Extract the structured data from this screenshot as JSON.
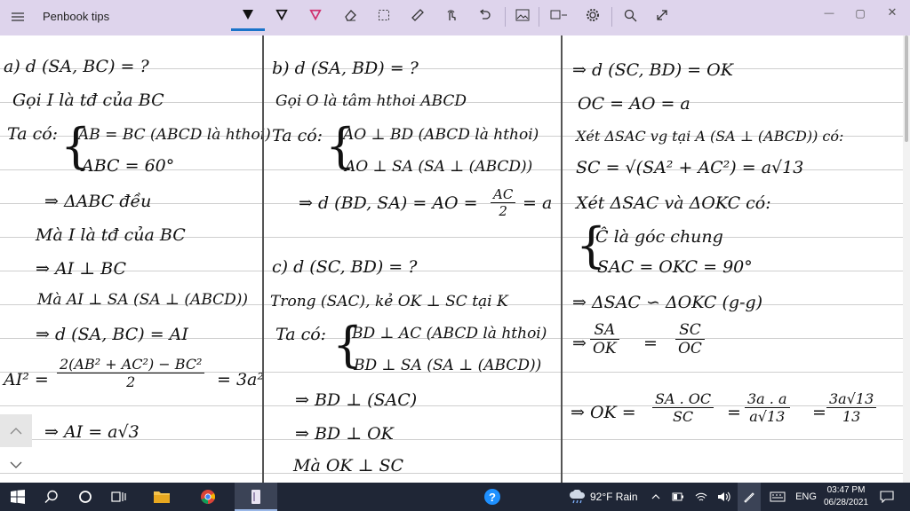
{
  "app": {
    "title": "Penbook tips"
  },
  "toolbar": {
    "icons": [
      "pen-icon",
      "pen-icon",
      "highlighter-icon",
      "eraser-icon",
      "lasso-icon",
      "ruler-icon",
      "touch-icon",
      "undo-icon",
      "image-icon",
      "shape-icon",
      "settings-icon",
      "search-icon",
      "expand-icon"
    ]
  },
  "window": {
    "minimize": "—",
    "maximize": "▢",
    "close": "✕"
  },
  "col1": [
    "a) d (SA, BC) = ?",
    "Gọi I là tđ của BC",
    "Ta có:",
    "AB = BC (ABCD là hthoi)",
    "ABC = 60°",
    "⇒ ΔABC đều",
    "Mà I là tđ của BC",
    "⇒ AI ⊥ BC",
    "Mà AI ⊥ SA (SA ⊥ (ABCD))",
    "⇒ d (SA, BC) = AI",
    "AI² =",
    "2(AB² + AC²) − BC²",
    "2",
    "= 3a²",
    "⇒ AI = a√3"
  ],
  "col2": [
    "b) d (SA, BD) = ?",
    "Gọi O là tâm hthoi ABCD",
    "Ta có:",
    "AO ⊥ BD (ABCD là hthoi)",
    "AO ⊥ SA (SA ⊥ (ABCD))",
    "⇒ d (BD, SA) = AO =",
    "AC",
    "2",
    "= a",
    "c) d (SC, BD) = ?",
    "Trong (SAC), kẻ OK ⊥ SC tại K",
    "Ta có:",
    "BD ⊥ AC (ABCD là hthoi)",
    "BD ⊥ SA (SA ⊥ (ABCD))",
    "⇒ BD ⊥ (SAC)",
    "⇒ BD ⊥ OK",
    "Mà OK ⊥ SC"
  ],
  "col3": [
    "⇒ d (SC, BD) = OK",
    "OC = AO = a",
    "Xét ΔSAC vg tại A (SA ⊥ (ABCD)) có:",
    "SC = √(SA² + AC²) = a√13",
    "Xét ΔSAC và ΔOKC có:",
    "Ĉ là góc chung",
    "SAC = OKC = 90°",
    "⇒ ΔSAC ∽ ΔOKC (g-g)",
    "⇒",
    "SA",
    "OK",
    "=",
    "SC",
    "OC",
    "⇒ OK =",
    "SA . OC",
    "SC",
    "=",
    "3a . a",
    "a√13",
    "=",
    "3a√13",
    "13"
  ],
  "taskbar": {
    "weather": "92°F Rain",
    "language": "ENG",
    "time": "03:47 PM",
    "date": "06/28/2021"
  }
}
